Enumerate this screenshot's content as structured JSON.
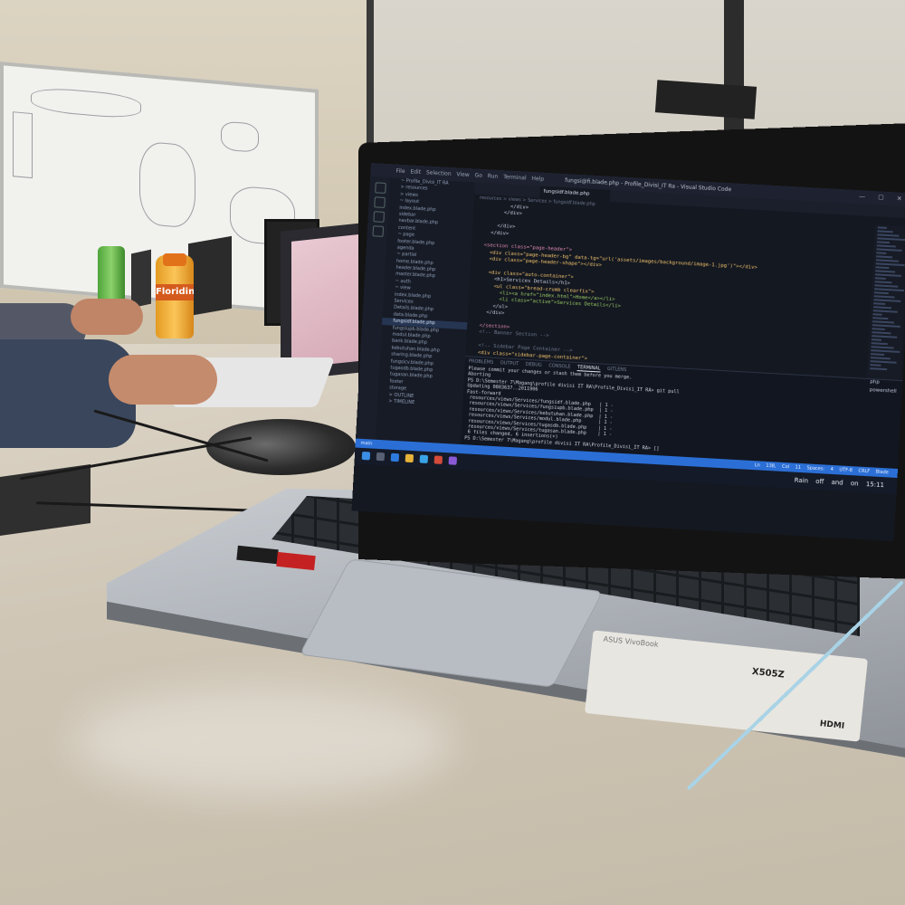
{
  "window": {
    "title": "fungsi@fi.blade.php - Profile_Divisi_IT Ra - Visual Studio Code",
    "menu": "File Edit Selection View Go Run Terminal Help"
  },
  "tabs": [
    {
      "label": "",
      "active": false
    },
    {
      "label": "fungsidf.blade.php",
      "active": true
    },
    {
      "label": "",
      "active": false
    },
    {
      "label": "",
      "active": false
    }
  ],
  "sidebar": {
    "items": [
      "~ Profile_Divisi_IT RA",
      "> resources",
      "> views",
      "~ layout",
      "  index.blade.php",
      "  sidebar",
      "  navbar.blade.php",
      "  content",
      "~ page",
      "  footer.blade.php",
      "  agenda",
      "  ~ partial",
      "  home.blade.php",
      "  header.blade.php",
      "  master.blade.php",
      "~ auth",
      "~ view",
      "  index.blade.php",
      "  Services",
      "  Details.blade.php",
      "  data.blade.php",
      "  fungsidf.blade.php",
      "  fungsiupb.blade.php",
      "  modul.blade.php",
      "  bank.blade.php",
      "  kebutuhan.blade.php",
      "  sharing.blade.php",
      "  fungsicv.blade.php",
      "  tugasdb.blade.php",
      "  tugasan.blade.php",
      "  footer",
      "  storage",
      "> OUTLINE",
      "> TIMELINE"
    ],
    "active_index": 21
  },
  "editor": {
    "lines": [
      {
        "t": "            </div>",
        "c": ""
      },
      {
        "t": "          </div>",
        "c": ""
      },
      {
        "t": "",
        "c": ""
      },
      {
        "t": "        </div>",
        "c": ""
      },
      {
        "t": "      </div>",
        "c": ""
      },
      {
        "t": "",
        "c": ""
      },
      {
        "t": "    <section class=\"page-header\">",
        "c": "kw"
      },
      {
        "t": "      <div class=\"page-header-bg\" data-tg=\"url('assets/images/background/image-1.jpg')\"></div>",
        "c": "at"
      },
      {
        "t": "      <div class=\"page-header-shape\"></div>",
        "c": "at"
      },
      {
        "t": "",
        "c": ""
      },
      {
        "t": "      <div class=\"auto-container\">",
        "c": "at"
      },
      {
        "t": "        <h1>Services Details</h1>",
        "c": ""
      },
      {
        "t": "        <ul class=\"bread-crumb clearfix\">",
        "c": "at"
      },
      {
        "t": "          <li><a href=\"index.html\">Home</a></li>",
        "c": "st"
      },
      {
        "t": "          <li class=\"active\">Services Details</li>",
        "c": "st"
      },
      {
        "t": "        </ul>",
        "c": ""
      },
      {
        "t": "      </div>",
        "c": ""
      },
      {
        "t": "",
        "c": ""
      },
      {
        "t": "    </section>",
        "c": "kw"
      },
      {
        "t": "    <!-- Banner Section -->",
        "c": "cm"
      },
      {
        "t": "",
        "c": ""
      },
      {
        "t": "    <!-- Sidebar Page Container -->",
        "c": "cm"
      },
      {
        "t": "    <div class=\"sidebar-page-container\">",
        "c": "at"
      }
    ]
  },
  "panel": {
    "tabs": [
      "PROBLEMS",
      "OUTPUT",
      "DEBUG CONSOLE",
      "TERMINAL",
      "GITLENS"
    ],
    "active": 3,
    "lines": [
      "Please commit your changes or stash them before you merge.",
      "Aborting",
      "PS D:\\Semester 7\\Magang\\profile divisi IT RA\\Profile_Divisi_IT RA> git pull",
      "Updating 0803637..2011906",
      "Fast-forward",
      " resources/views/Services/fungsidf.blade.php   | 1 -",
      " resources/views/Services/fungsiupb.blade.php  | 1 -",
      " resources/views/Services/kebutuhan.blade.php  | 1 -",
      " resources/views/Services/modul.blade.php      | 1 -",
      " resources/views/Services/tugasdb.blade.php    | 1 -",
      " resources/views/Services/tugasan.blade.php    | 1 -",
      " 6 files changed, 6 insertions(+)",
      "PS D:\\Semester 7\\Magang\\profile divisi IT RA\\Profile_Divisi_IT RA> []"
    ],
    "shells": [
      "php",
      "powershell"
    ]
  },
  "statusbar": {
    "left": "main",
    "right": "Ln 138, Col 11  Spaces: 4  UTF-8  CRLF  Blade"
  },
  "taskbar": {
    "weather": "Rain off and on",
    "time": "15:11"
  },
  "breadcrumb": "resources > views > Services > fungsidf.blade.php",
  "laptop": {
    "brand_sticker": "ASUS VivoBook",
    "model": "X505Z",
    "port_logo": "HDMI"
  },
  "bottle_label": "Floridina"
}
